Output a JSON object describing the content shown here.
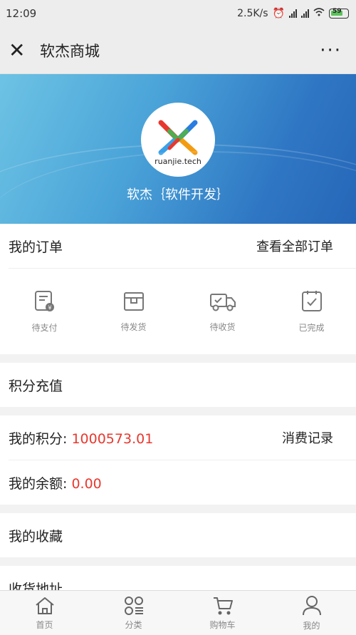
{
  "status_bar": {
    "time": "12:09",
    "net_speed": "2.5K/s",
    "battery": "59"
  },
  "nav": {
    "close_icon": "close-icon",
    "title": "软杰商城",
    "more": "···"
  },
  "banner": {
    "logo_text": "ruanjie.tech",
    "shop_name": "软杰｛软件开发｝"
  },
  "orders": {
    "title": "我的订单",
    "view_all": "查看全部订单",
    "items": [
      {
        "label": "待支付",
        "icon": "pending-payment-icon"
      },
      {
        "label": "待发货",
        "icon": "pending-shipment-icon"
      },
      {
        "label": "待收货",
        "icon": "truck-icon"
      },
      {
        "label": "已完成",
        "icon": "completed-icon"
      }
    ]
  },
  "recharge": {
    "label": "积分充值"
  },
  "points": {
    "label": "我的积分: ",
    "value": "1000573.01",
    "record": "消费记录"
  },
  "balance": {
    "label": "我的余额: ",
    "value": "0.00"
  },
  "favorites": {
    "label": "我的收藏"
  },
  "address": {
    "label": "收货地址"
  },
  "tabbar": [
    {
      "label": "首页",
      "icon": "home-icon"
    },
    {
      "label": "分类",
      "icon": "category-icon"
    },
    {
      "label": "购物车",
      "icon": "cart-icon"
    },
    {
      "label": "我的",
      "icon": "user-icon"
    }
  ],
  "colors": {
    "accent_red": "#e8382e",
    "banner_blue": "#2f77c4"
  }
}
